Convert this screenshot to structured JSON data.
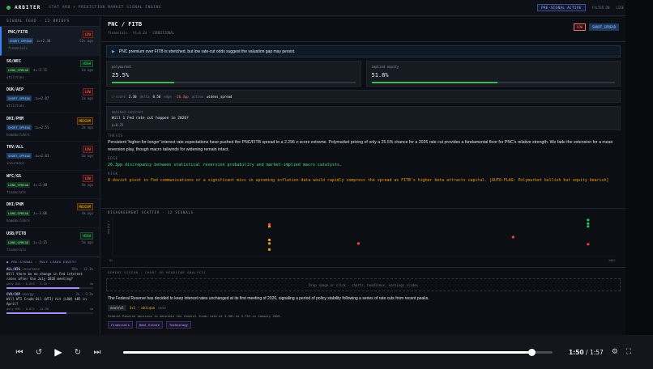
{
  "app": {
    "brand": "ARBITER",
    "subtitle": "STAT ARB × PREDICTION MARKET SIGNAL ENGINE",
    "status": "PRE-SIGNAL ACTIVE",
    "meta1": "FILTER ON",
    "meta2": "LIVE"
  },
  "sidebar": {
    "header": "SIGNAL FEED · 12 BRIEFS",
    "briefs": [
      {
        "pair": "PNC/FITB",
        "tag": "LOW",
        "tag_type": "low",
        "dir": "SHORT_SPREAD",
        "dir_type": "short",
        "z": "z=+2.30",
        "ago": "52s ago",
        "sector": "financials",
        "active": true
      },
      {
        "pair": "SO/WEC",
        "tag": "HIGH",
        "tag_type": "high",
        "dir": "LONG_SPREAD",
        "dir_type": "long",
        "z": "z=-2.71",
        "ago": "1m ago",
        "sector": "utilities",
        "active": false
      },
      {
        "pair": "DUK/AEP",
        "tag": "LOW",
        "tag_type": "low",
        "dir": "SHORT_SPREAD",
        "dir_type": "short",
        "z": "z=+2.07",
        "ago": "1m ago",
        "sector": "utilities",
        "active": false
      },
      {
        "pair": "DHI/PHM",
        "tag": "MEDIUM",
        "tag_type": "medium",
        "dir": "SHORT_SPREAD",
        "dir_type": "short",
        "z": "z=+2.51",
        "ago": "2m ago",
        "sector": "homebuilders",
        "active": false
      },
      {
        "pair": "TRV/ALL",
        "tag": "LOW",
        "tag_type": "low",
        "dir": "SHORT_SPREAD",
        "dir_type": "short",
        "z": "z=+2.01",
        "ago": "3m ago",
        "sector": "insurance",
        "active": false
      },
      {
        "pair": "WFC/GS",
        "tag": "LOW",
        "tag_type": "low",
        "dir": "LONG_SPREAD",
        "dir_type": "long",
        "z": "z=-2.48",
        "ago": "4m ago",
        "sector": "financials",
        "active": false
      },
      {
        "pair": "DHI/PHM",
        "tag": "MEDIUM",
        "tag_type": "medium",
        "dir": "LONG_SPREAD",
        "dir_type": "long",
        "z": "z=-3.06",
        "ago": "4m ago",
        "sector": "homebuilders",
        "active": false
      },
      {
        "pair": "USB/FITB",
        "tag": "HIGH",
        "tag_type": "high",
        "dir": "LONG_SPREAD",
        "dir_type": "long",
        "z": "z=-2.15",
        "ago": "5m ago",
        "sector": "financials",
        "active": false
      }
    ],
    "presignal": {
      "header": "PRE-SIGNAL · POLY LEADS EQUITY",
      "items": [
        {
          "pair": "ALL/HIG",
          "sector": "insurance",
          "right": "84% · 12.1%",
          "question": "Will there be no change in Fed interest rates after the July 2026 meeting?",
          "meta": "poly 84% · 0.659 · 3.10",
          "ago": "4m",
          "fill": 0.84
        },
        {
          "pair": "CVX/COP",
          "sector": "energy",
          "right": "3% · 9.3%",
          "question": "Will WTI Crude Oil (WTI) hit (LOW) $85 in April?",
          "meta": "poly 69% · 0.07% · 12.58",
          "ago": "4m",
          "fill": 0.69
        }
      ]
    }
  },
  "detail": {
    "title": "PNC / FITB",
    "sub": "financials · hl=6.2d · CONDITIONAL",
    "tag_low": "LOW",
    "tag_dir": "SHORT_SPREAD",
    "alert": "PNC premium over FITB is stretched, but low rate-cut odds suggest the valuation gap may persist.",
    "polymarket_label": "polymarket",
    "polymarket_value": "25.5%",
    "polymarket_fill": 0.255,
    "equity_label": "implied equity",
    "equity_value": "51.8%",
    "equity_fill": 0.518,
    "stats": {
      "z_label": "z-score",
      "z_value": "2.30",
      "beta_label": "delta",
      "beta_value": "0.50",
      "edge_label": "edge",
      "edge_value": "-26.3pp",
      "action_label": "action",
      "action_value": "widens_spread"
    },
    "matched": {
      "label": "matched contract",
      "question": "Will 1 Fed rate cut happen in 2026?",
      "price": "p=0.25"
    },
    "thesis_label": "THESIS",
    "thesis": "Persistent 'higher-for-longer' interest rate expectations have pushed the PNC/FITB spread to a 2.296 z-score extreme. Polymarket pricing of only a 25.5% chance for a 2026 rate cut provides a fundamental floor for PNC's relative strength. We fade the extension for a mean reversion play, though macro tailwinds for widening remain intact.",
    "edge_label": "EDGE",
    "edge": "26.3pp discrepancy between statistical reversion probability and market-implied macro catalysts.",
    "risk_label": "RISK",
    "risk": "A dovish pivot in Fed communications or a significant miss in upcoming inflation data would rapidly compress the spread as FITB's higher beta attracts capital. [AUTO-FLAG: Polymarket bullish but equity bearish]"
  },
  "scatter": {
    "title": "DISAGREEMENT SCATTER · 12 SIGNALS",
    "ylabel": "equity ↑",
    "x_max_label": "100%",
    "x_min_label": "0%"
  },
  "chart_data": {
    "type": "scatter",
    "title": "DISAGREEMENT SCATTER · 12 SIGNALS",
    "xlabel": "",
    "ylabel": "equity ↑",
    "xlim": [
      0,
      100
    ],
    "points": [
      {
        "x": 30,
        "y": 0.86,
        "color": "#ef4444"
      },
      {
        "x": 30,
        "y": 0.8,
        "color": "#f59e0b"
      },
      {
        "x": 30,
        "y": 0.42,
        "color": "#f59e0b"
      },
      {
        "x": 30,
        "y": 0.32,
        "color": "#f59e0b"
      },
      {
        "x": 30,
        "y": 0.15,
        "color": "#f59e0b"
      },
      {
        "x": 49,
        "y": 0.32,
        "color": "#ef4444"
      },
      {
        "x": 82,
        "y": 0.5,
        "color": "#ef4444"
      },
      {
        "x": 98,
        "y": 0.98,
        "color": "#22c55e"
      },
      {
        "x": 98,
        "y": 0.88,
        "color": "#22c55e"
      },
      {
        "x": 98,
        "y": 0.8,
        "color": "#22c55e"
      },
      {
        "x": 98,
        "y": 0.3,
        "color": "#ef4444"
      }
    ]
  },
  "vision": {
    "header": "GEMINI VISION · CHART OR HEADLINE ANALYSIS",
    "dropzone": "Drop image or click · charts, headlines, earnings slides",
    "headline": "The Federal Reserve has decided to keep interest rates unchanged at its first meeting of 2026, signaling a period of policy stability following a series of rate cuts from recent peaks.",
    "sent_neutral": "neutral",
    "sent_rate": "3+1 · oblique",
    "sent_extra": "note",
    "caption": "Federal Reserve decision to maintain the federal funds rate at 3.50% to 3.75% in January 2026.",
    "chips": [
      "Financials",
      "Real Estate",
      "Technology"
    ]
  },
  "player": {
    "current": "1:50",
    "total": "1:57",
    "separator": " / ",
    "progress": 0.95,
    "icons": {
      "prev": "skip-back-icon",
      "rewind": "rewind-10-icon",
      "play": "play-icon",
      "forward": "forward-10-icon",
      "next": "skip-forward-icon",
      "settings": "settings-icon",
      "fullscreen": "fullscreen-icon"
    }
  }
}
